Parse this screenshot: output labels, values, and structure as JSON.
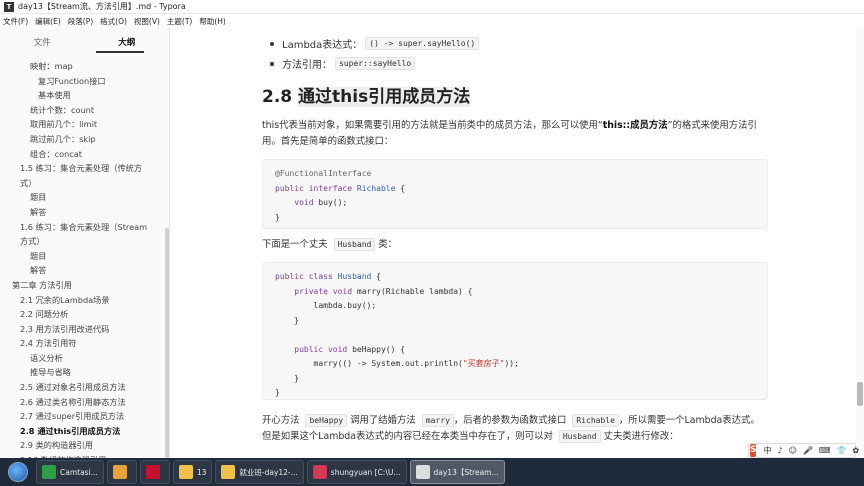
{
  "window": {
    "title": "day13【Stream流、方法引用】.md - Typora",
    "icon_letter": "T"
  },
  "menu": [
    "文件(F)",
    "编辑(E)",
    "段落(P)",
    "格式(O)",
    "视图(V)",
    "主题(T)",
    "帮助(H)"
  ],
  "sidebar": {
    "tabs": [
      {
        "label": "文件",
        "active": false
      },
      {
        "label": "大纲",
        "active": true
      }
    ],
    "outline": [
      {
        "label": "映射：map",
        "indent": 30
      },
      {
        "label": "复习Function接口",
        "indent": 38
      },
      {
        "label": "基本使用",
        "indent": 38
      },
      {
        "label": "统计个数：count",
        "indent": 30
      },
      {
        "label": "取用前几个：limit",
        "indent": 30
      },
      {
        "label": "跳过前几个：skip",
        "indent": 30
      },
      {
        "label": "组合：concat",
        "indent": 30
      },
      {
        "label": "1.5 练习：集合元素处理（传统方",
        "indent": 20
      },
      {
        "label": "式）",
        "indent": 20
      },
      {
        "label": "题目",
        "indent": 30
      },
      {
        "label": "解答",
        "indent": 30
      },
      {
        "label": "1.6 练习：集合元素处理（Stream",
        "indent": 20
      },
      {
        "label": "方式）",
        "indent": 20
      },
      {
        "label": "题目",
        "indent": 30
      },
      {
        "label": "解答",
        "indent": 30
      },
      {
        "label": "第二章 方法引用",
        "indent": 12
      },
      {
        "label": "2.1 冗余的Lambda场景",
        "indent": 20
      },
      {
        "label": "2.2 问题分析",
        "indent": 20
      },
      {
        "label": "2.3 用方法引用改进代码",
        "indent": 20
      },
      {
        "label": "2.4 方法引用符",
        "indent": 20
      },
      {
        "label": "语义分析",
        "indent": 30
      },
      {
        "label": "推导与省略",
        "indent": 30
      },
      {
        "label": "2.5 通过对象名引用成员方法",
        "indent": 20
      },
      {
        "label": "2.6 通过类名称引用静态方法",
        "indent": 20
      },
      {
        "label": "2.7 通过super引用成员方法",
        "indent": 20
      },
      {
        "label": "2.8 通过this引用成员方法",
        "indent": 20,
        "bold": true
      },
      {
        "label": "2.9 类的构造器引用",
        "indent": 20
      },
      {
        "label": "2.10 数组的构造器引用",
        "indent": 20
      }
    ]
  },
  "content": {
    "bullet1": {
      "text": "Lambda表达式：",
      "code": "() -> super.sayHello()"
    },
    "bullet2": {
      "text": "方法引用：",
      "code": "super::sayHello"
    },
    "heading": {
      "num": "2.8",
      "text": "通过this引用成员方法"
    },
    "para1": {
      "a": "this代表当前对象，如果需要引用的方法就是当前类中的成员方法，那么可以使用“",
      "b": "this::成员方法",
      "c": "”的格式来使用方法引用。首先是简单的函数式接口："
    },
    "code1": [
      [
        {
          "t": "@FunctionalInterface",
          "c": "an"
        }
      ],
      [
        {
          "t": "public interface ",
          "c": "kw"
        },
        {
          "t": "Richable",
          "c": "ty"
        },
        {
          "t": " {"
        }
      ],
      [
        {
          "t": "    "
        },
        {
          "t": "void",
          "c": "kw"
        },
        {
          "t": " buy();"
        }
      ],
      [
        {
          "t": "}"
        }
      ]
    ],
    "para2": {
      "a": "下面是一个丈夫 ",
      "code": "Husband",
      "b": " 类："
    },
    "code2": [
      [
        {
          "t": "public class ",
          "c": "kw"
        },
        {
          "t": "Husband",
          "c": "ty"
        },
        {
          "t": " {"
        }
      ],
      [
        {
          "t": "    "
        },
        {
          "t": "private void",
          "c": "kw"
        },
        {
          "t": " marry(Richable lambda) {"
        }
      ],
      [
        {
          "t": "        lambda.buy();"
        }
      ],
      [
        {
          "t": "    }"
        }
      ],
      [
        {
          "t": ""
        }
      ],
      [
        {
          "t": "    "
        },
        {
          "t": "public void",
          "c": "kw"
        },
        {
          "t": " beHappy() {"
        }
      ],
      [
        {
          "t": "        marry(() -> System.out.println("
        },
        {
          "t": "\"买套房子\"",
          "c": "st"
        },
        {
          "t": "));"
        }
      ],
      [
        {
          "t": "    }"
        }
      ],
      [
        {
          "t": "}"
        }
      ]
    ],
    "para3": {
      "a": "开心方法 ",
      "code1": "beHappy",
      "b": " 调用了结婚方法 ",
      "code2": "marry",
      "c": "，后者的参数为函数式接口 ",
      "code3": "Richable",
      "d": "，所以需要一个Lambda表达式。",
      "e": "但是如果这个Lambda表达式的内容已经在本类当中存在了，则可以对 ",
      "code4": "Husband",
      "f": " 丈夫类进行修改："
    }
  },
  "ime": {
    "logo": "S",
    "items": [
      "中",
      "♪",
      "☺",
      "🎤",
      "⌨",
      "👕",
      "✿",
      "⋯"
    ]
  },
  "taskbar": {
    "items": [
      {
        "label": "Camtasi...",
        "color": "#2e9f47",
        "active": false
      },
      {
        "label": "",
        "color": "#e9a33a",
        "active": false
      },
      {
        "label": "",
        "color": "#c8102e",
        "active": false
      },
      {
        "label": "13",
        "color": "#f0c24a",
        "active": false
      },
      {
        "label": "就业班-day12-...",
        "color": "#f0c24a",
        "active": false
      },
      {
        "label": "shungyuan [C:\\U...",
        "color": "#d43a57",
        "active": false
      },
      {
        "label": "day13【Stream...",
        "color": "#dddddd",
        "active": true
      }
    ]
  }
}
